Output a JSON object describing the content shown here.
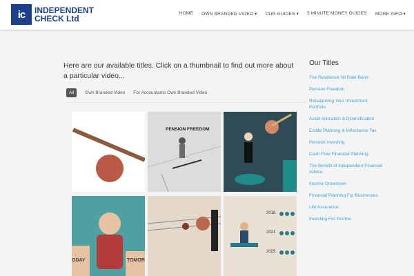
{
  "header": {
    "logo_mark": "ic",
    "logo_line1": "INDEPENDENT",
    "logo_line2": "CHECK Ltd",
    "nav": [
      "HOME",
      "OWN BRANDED VIDEO ▾",
      "OUR GUIDES ▾",
      "5 MINUTE MONEY GUIDES",
      "MORE INFO ▾"
    ]
  },
  "main": {
    "intro": "Here are our available titles. Click on a thumbnail to find out more about a particular video...",
    "filters": [
      "All",
      "Own Branded Video",
      "For Accountants Own Branded Video"
    ],
    "thumbs": {
      "pension_freedom_caption": "PENSION FREEDOM",
      "today": "ODAY",
      "tomorrow": "TOMOR",
      "years": [
        "2018",
        "2021",
        "2025"
      ]
    }
  },
  "sidebar": {
    "title": "Our Titles",
    "items": [
      "The Residence Nil Rate Band",
      "Pension Freedom",
      "Rebalancing Your Investment Portfolio",
      "Asset Allocation & Diversification",
      "Estate Planning & Inheritance Tax",
      "Pension Investing",
      "Cash Flow Financial Planning",
      "The Benefit of Independent Financial Advice",
      "Income Drawdown",
      "Financial Planning For Businesses",
      "Life Assurance",
      "Investing For Income"
    ]
  },
  "colors": {
    "brand": "#1c3f8a",
    "link": "#3aa3d4",
    "filter_active_bg": "#555555"
  }
}
